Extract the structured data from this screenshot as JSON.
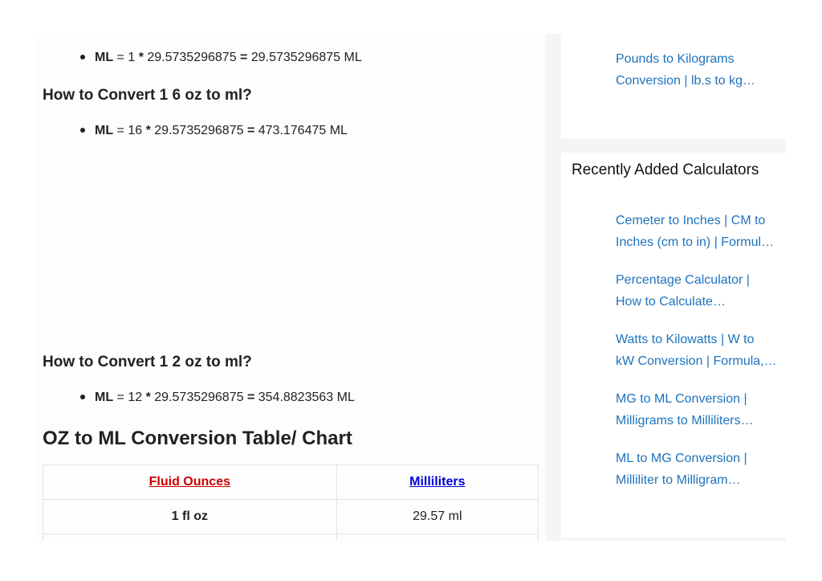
{
  "content": {
    "formula_1": {
      "label": "ML",
      "lhs": " = 1 ",
      "op": "*",
      "factor": " 29.5735296875 ",
      "eq": "=",
      "result": " 29.5735296875 ML"
    },
    "heading_16oz": "How to Convert 1 6 oz to ml?",
    "formula_2": {
      "label": "ML",
      "lhs": " = 16 ",
      "op": "*",
      "factor": " 29.5735296875 ",
      "eq": "=",
      "result": " 473.176475 ML"
    },
    "heading_12oz": "How to Convert 1 2 oz to ml?",
    "formula_3": {
      "label": "ML",
      "lhs": " = 12 ",
      "op": "*",
      "factor": " 29.5735296875 ",
      "eq": "=",
      "result": " 354.8823563 ML"
    },
    "table_heading": "OZ to ML Conversion Table/ Chart",
    "table": {
      "col_left": "Fluid Ounces",
      "col_right": "Milliliters",
      "col_left_color": "#cc0000",
      "col_right_color": "#0000dd",
      "rows": [
        {
          "oz": "1 fl oz",
          "ml": "29.57 ml"
        }
      ]
    }
  },
  "sidebar": {
    "top_link": {
      "line1": "Pounds to Kilograms",
      "line2": "Conversion | lb.s to kg…"
    },
    "recent_heading": "Recently Added Calculators",
    "recent_links": [
      {
        "line1": "Cemeter to Inches | CM to",
        "line2": "Inches (cm to in) | Formul…"
      },
      {
        "line1": "Percentage Calculator |",
        "line2": "How to Calculate…"
      },
      {
        "line1": "Watts to Kilowatts | W to",
        "line2": "kW Conversion | Formula,…"
      },
      {
        "line1": "MG to ML Conversion |",
        "line2": "Milligrams to Milliliters…"
      },
      {
        "line1": "ML to MG Conversion |",
        "line2": "Milliliter to Milligram…"
      }
    ],
    "link_color": "#1e73be"
  }
}
